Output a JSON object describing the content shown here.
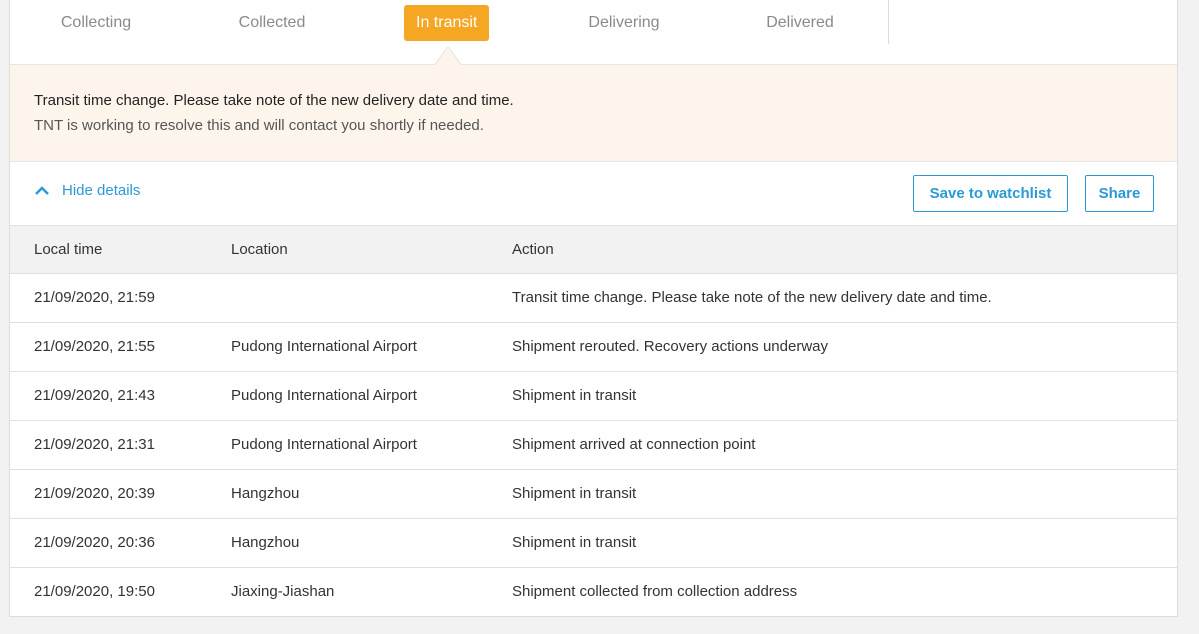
{
  "steps": [
    "Collecting",
    "Collected",
    "In transit",
    "Delivering",
    "Delivered"
  ],
  "notice": {
    "title": "Transit time change. Please take note of the new delivery date and time.",
    "body": "TNT is working to resolve this and will contact you shortly if needed."
  },
  "toolbar": {
    "hide_details": "Hide details",
    "watchlist": "Save to watchlist",
    "share": "Share"
  },
  "table": {
    "headers": [
      "Local time",
      "Location",
      "Action"
    ],
    "rows": [
      [
        "21/09/2020, 21:59",
        "",
        "Transit time change. Please take note of the new delivery date and time."
      ],
      [
        "21/09/2020, 21:55",
        "Pudong International Airport",
        "Shipment rerouted. Recovery actions underway"
      ],
      [
        "21/09/2020, 21:43",
        "Pudong International Airport",
        "Shipment in transit"
      ],
      [
        "21/09/2020, 21:31",
        "Pudong International Airport",
        "Shipment arrived at connection point"
      ],
      [
        "21/09/2020, 20:39",
        "Hangzhou",
        "Shipment in transit"
      ],
      [
        "21/09/2020, 20:36",
        "Hangzhou",
        "Shipment in transit"
      ],
      [
        "21/09/2020, 19:50",
        "Jiaxing-Jiashan",
        "Shipment collected from collection address"
      ]
    ]
  },
  "colors": {
    "accent": "#f5a623",
    "link": "#2a9ad6",
    "notice_bg": "#fdf5eb"
  }
}
